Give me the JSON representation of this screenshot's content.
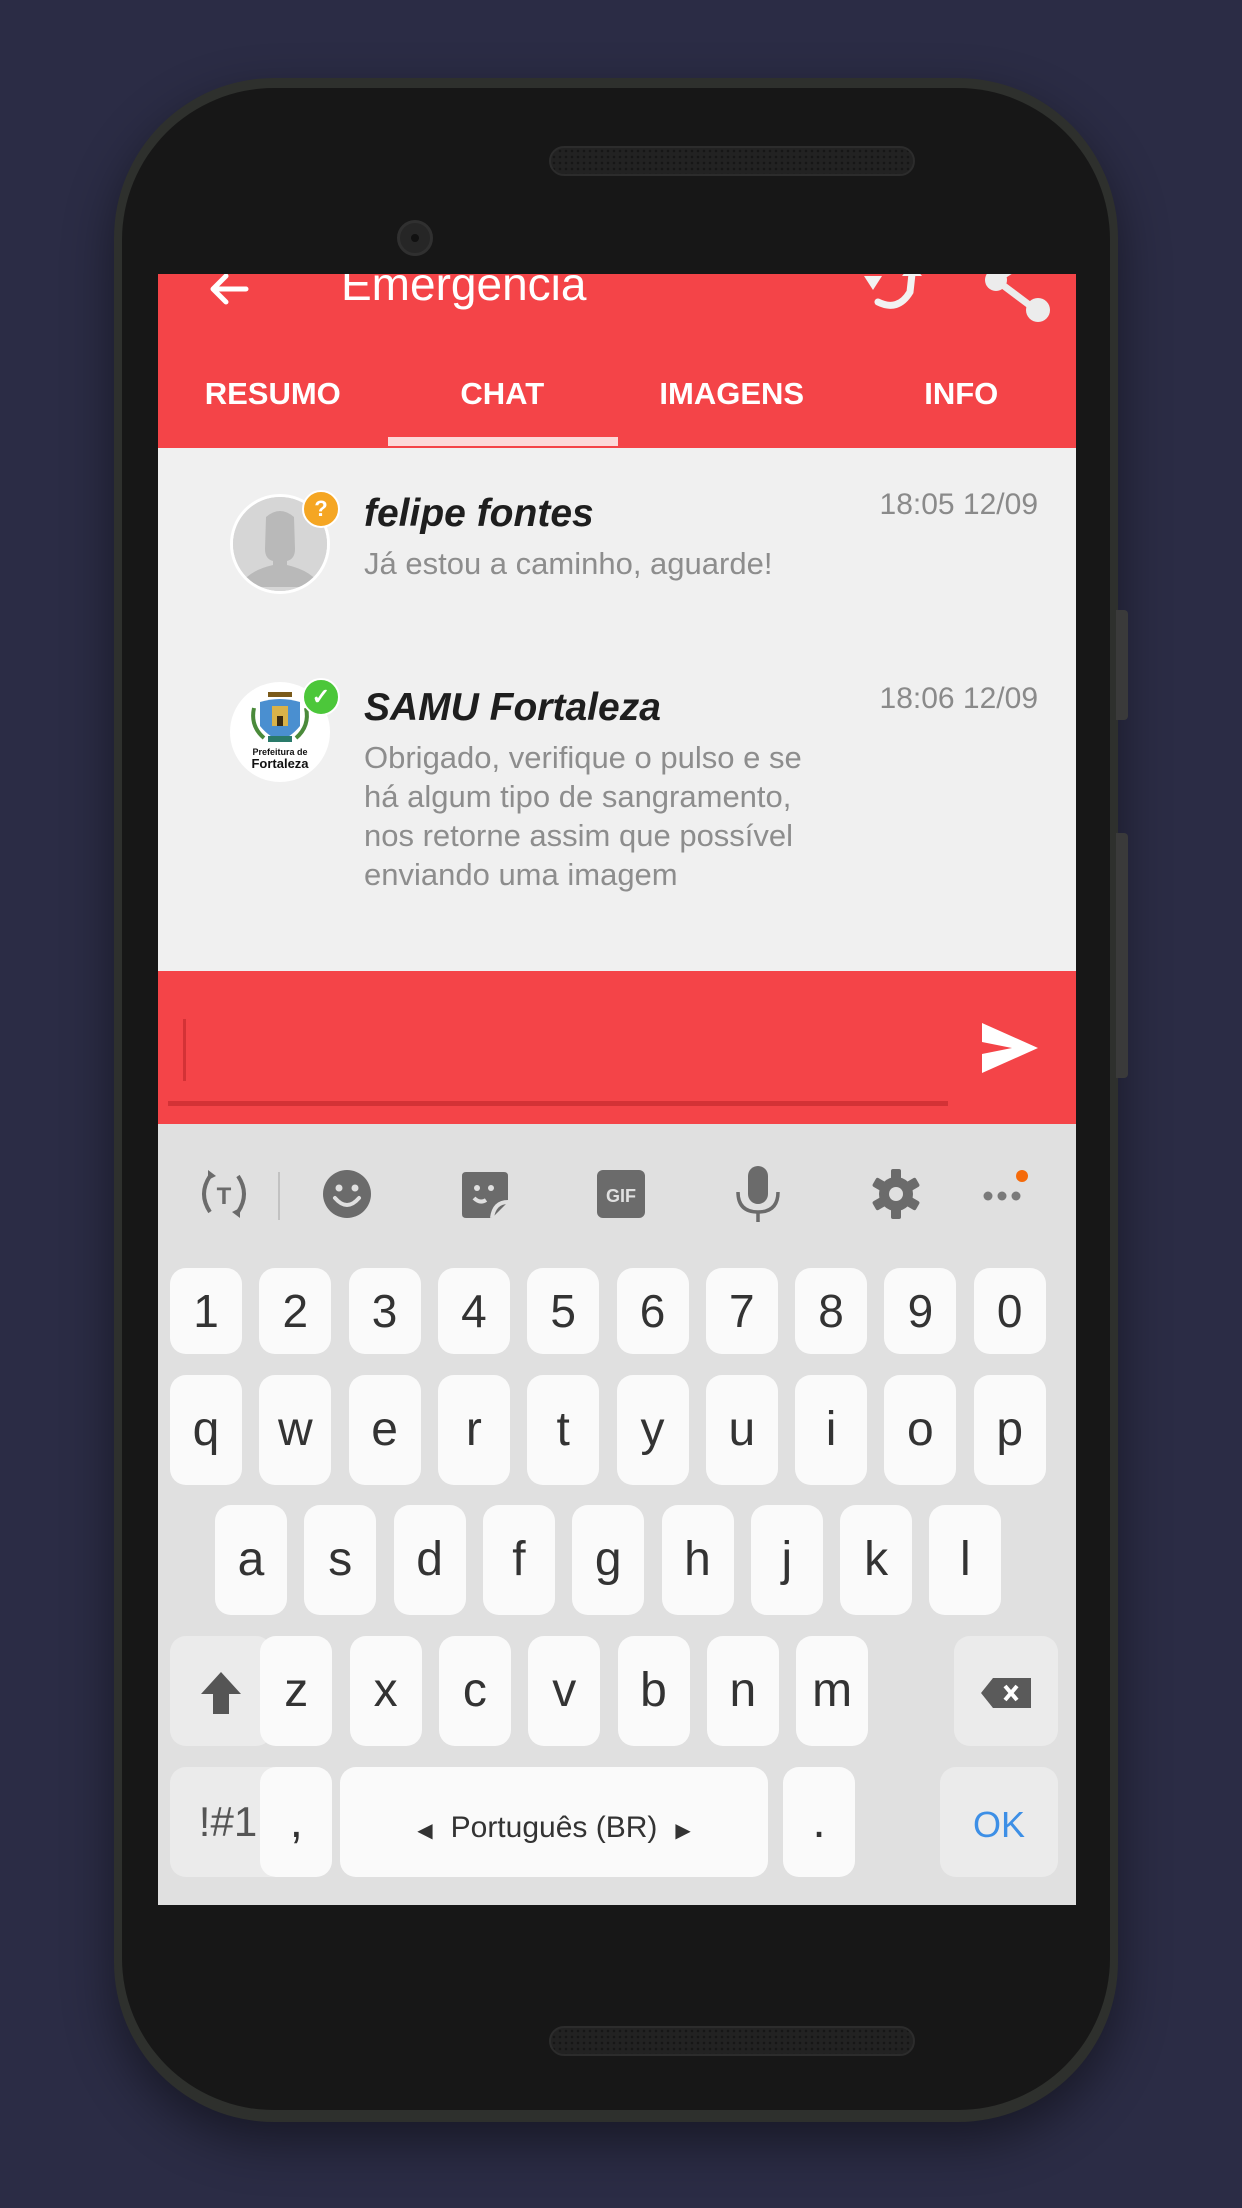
{
  "app": {
    "title": "Emergencia",
    "header_actions": [
      {
        "name": "back",
        "icon": "arrow-left-icon"
      },
      {
        "name": "sync",
        "icon": "sync-icon"
      },
      {
        "name": "share",
        "icon": "share-icon"
      }
    ],
    "tabs": [
      {
        "label": "RESUMO",
        "active": false
      },
      {
        "label": "CHAT",
        "active": true
      },
      {
        "label": "IMAGENS",
        "active": false
      },
      {
        "label": "INFO",
        "active": false
      }
    ],
    "accent_color": "#f44448"
  },
  "chat": {
    "messages": [
      {
        "sender": "felipe fontes",
        "time": "18:05 12/09",
        "text": "Já estou a caminho, aguarde!",
        "avatar": "default-user-avatar",
        "status_badge": {
          "icon": "question-icon",
          "glyph": "?",
          "color": "#f5a623"
        }
      },
      {
        "sender": "SAMU Fortaleza",
        "time": "18:06 12/09",
        "text": "Obrigado, verifique o pulso e se há algum tipo de sangramento, nos retorne assim que possível enviando uma imagem",
        "avatar": "prefeitura-fortaleza-logo",
        "avatar_caption_top": "Prefeitura de",
        "avatar_caption_bottom": "Fortaleza",
        "status_badge": {
          "icon": "check-icon",
          "glyph": "✓",
          "color": "#4cc73a"
        }
      }
    ]
  },
  "composer": {
    "value": "",
    "placeholder": "",
    "send_icon": "send-icon"
  },
  "keyboard": {
    "toolbar": [
      {
        "name": "translate",
        "icon": "translate-icon"
      },
      {
        "name": "emoji",
        "icon": "emoji-icon"
      },
      {
        "name": "sticker",
        "icon": "sticker-icon"
      },
      {
        "name": "gif",
        "icon": "gif-icon",
        "label": "GIF"
      },
      {
        "name": "voice",
        "icon": "microphone-icon"
      },
      {
        "name": "settings",
        "icon": "gear-icon"
      },
      {
        "name": "more",
        "icon": "more-icon",
        "notification_dot": "#f56a0a"
      }
    ],
    "number_row": [
      "1",
      "2",
      "3",
      "4",
      "5",
      "6",
      "7",
      "8",
      "9",
      "0"
    ],
    "row1": [
      "q",
      "w",
      "e",
      "r",
      "t",
      "y",
      "u",
      "i",
      "o",
      "p"
    ],
    "row2": [
      "a",
      "s",
      "d",
      "f",
      "g",
      "h",
      "j",
      "k",
      "l"
    ],
    "row3": [
      "z",
      "x",
      "c",
      "v",
      "b",
      "n",
      "m"
    ],
    "symbols_label": "!#1",
    "comma": ",",
    "space_label": "Português (BR)",
    "period": ".",
    "action_label": "OK"
  }
}
